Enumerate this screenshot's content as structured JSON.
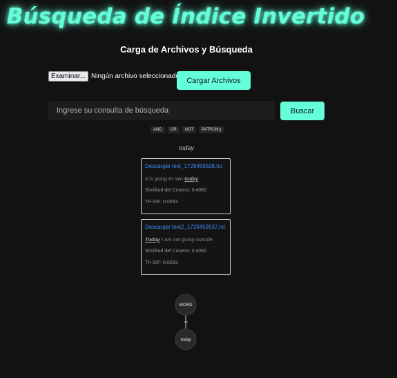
{
  "header": {
    "title": "Búsqueda de Índice Invertido",
    "subtitle": "Carga de Archivos y Búsqueda"
  },
  "upload": {
    "browse_label": "Examinar...",
    "file_status": "Ningún archivo seleccionado.",
    "upload_button": "Cargar Archivos"
  },
  "search": {
    "placeholder": "Ingrese su consulta de búsqueda",
    "button": "Buscar",
    "operators": [
      "AND",
      "OR",
      "NOT",
      "PATRON()"
    ]
  },
  "results": {
    "query": "today",
    "items": [
      {
        "link": "Descargar text_1729459508.txt",
        "snippet_before": "It is going to rain ",
        "snippet_highlight": "today",
        "snippet_after": ".",
        "cosine": "Similitud del Coseno: 0.4082",
        "tfidf": "TF-IDF: 0.0293"
      },
      {
        "link": "Descargar text2_1729459537.txt",
        "snippet_before": "",
        "snippet_highlight": "Today",
        "snippet_after": " I am not going outside.",
        "cosine": "Similitud del Coseno: 0.4082",
        "tfidf": "TF-IDF: 0.0293"
      }
    ]
  },
  "graph": {
    "nodes": [
      "WORD",
      "today"
    ],
    "edge_label": "raiz"
  },
  "colors": {
    "accent": "#64ffda",
    "background": "#121212",
    "link": "#3d8bfd",
    "node_fill": "#2a2a2a"
  }
}
